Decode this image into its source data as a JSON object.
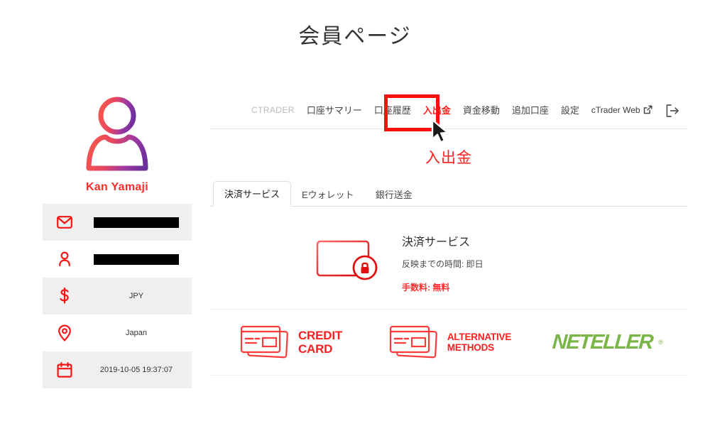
{
  "page": {
    "title": "会員ページ"
  },
  "profile": {
    "avatar_icon": "user-avatar-icon",
    "name": "Kan Yamaji",
    "rows": [
      {
        "icon": "mail-icon",
        "value": "",
        "redacted": true,
        "shaded": true
      },
      {
        "icon": "person-icon",
        "value": "",
        "redacted": true,
        "shaded": false
      },
      {
        "icon": "dollar-icon",
        "value": "JPY",
        "redacted": false,
        "shaded": true
      },
      {
        "icon": "location-icon",
        "value": "Japan",
        "redacted": false,
        "shaded": false
      },
      {
        "icon": "calendar-icon",
        "value": "2019-10-05 19:37:07",
        "redacted": false,
        "shaded": true
      }
    ]
  },
  "nav": {
    "items": [
      {
        "label": "CTRADER",
        "state": "muted"
      },
      {
        "label": "口座サマリー",
        "state": "normal"
      },
      {
        "label": "口座履歴",
        "state": "normal"
      },
      {
        "label": "入出金",
        "state": "active"
      },
      {
        "label": "資金移動",
        "state": "normal"
      },
      {
        "label": "追加口座",
        "state": "normal"
      },
      {
        "label": "設定",
        "state": "normal"
      }
    ],
    "external_link": {
      "label": "cTrader Web",
      "icon": "external-link-icon"
    },
    "logout_icon": "logout-icon"
  },
  "section": {
    "heading": "入出金"
  },
  "tabs": [
    {
      "label": "決済サービス",
      "active": true
    },
    {
      "label": "Eウォレット",
      "active": false
    },
    {
      "label": "銀行送金",
      "active": false
    }
  ],
  "service": {
    "icon": "credit-card-lock-icon",
    "title": "決済サービス",
    "processing_time": "反映までの時間: 即日",
    "fee": "手数料: 無料"
  },
  "logos": [
    {
      "icon": "credit-card-stack-icon",
      "line1": "CREDIT",
      "line2": "CARD",
      "style": "large"
    },
    {
      "icon": "credit-card-stack-icon",
      "line1": "ALTERNATIVE",
      "line2": "METHODS",
      "style": "small"
    },
    {
      "icon": "neteller-wordmark",
      "line1": "NETELLER",
      "line2": "",
      "style": "neteller"
    }
  ],
  "annotation": {
    "highlight_target": "入出金",
    "box_color": "#fb0f0f",
    "cursor_icon": "mouse-pointer-icon"
  },
  "colors": {
    "brand_red": "#ff1f1f",
    "accent_red": "#fa2020",
    "neteller_green": "#7ab547",
    "row_shade": "#efefef",
    "text_dark": "#333333"
  }
}
